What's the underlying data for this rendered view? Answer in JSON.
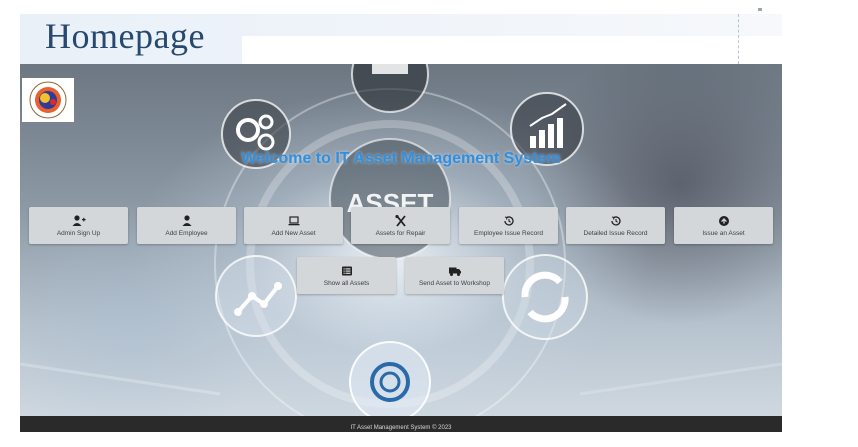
{
  "header": {
    "title": "Homepage"
  },
  "hero": {
    "welcome": "Welcome to IT Asset Management System",
    "background_text": "ASSET"
  },
  "actions": [
    {
      "label": "Admin Sign Up",
      "icon": "user-plus-icon"
    },
    {
      "label": "Add Employee",
      "icon": "user-icon"
    },
    {
      "label": "Add New Asset",
      "icon": "laptop-icon"
    },
    {
      "label": "Assets for Repair",
      "icon": "tools-icon"
    },
    {
      "label": "Employee Issue Record",
      "icon": "history-icon"
    },
    {
      "label": "Detailed Issue Record",
      "icon": "history-icon"
    },
    {
      "label": "Issue an Asset",
      "icon": "upload-circle-icon"
    },
    {
      "label": "Show all Assets",
      "icon": "list-icon"
    },
    {
      "label": "Send Asset to Workshop",
      "icon": "truck-icon"
    }
  ],
  "footer": {
    "text": "IT Asset Management System © 2023"
  },
  "colors": {
    "title": "#27496d",
    "welcome": "#2f8fe0",
    "button_bg": "#d4d7da",
    "footer_bg": "#2a2a2b"
  }
}
